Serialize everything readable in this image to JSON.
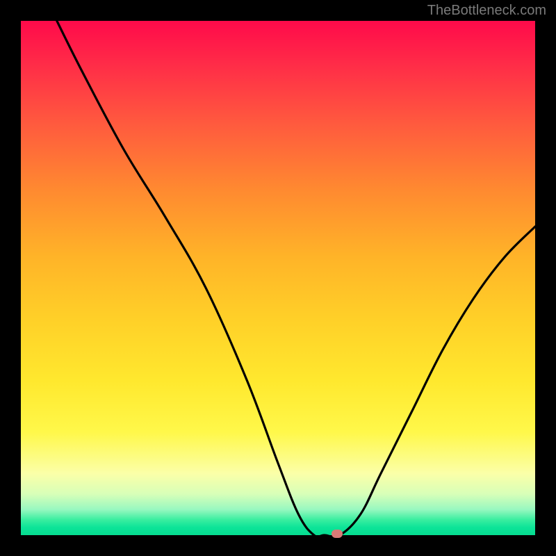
{
  "attribution": "TheBottleneck.com",
  "chart_data": {
    "type": "line",
    "title": "",
    "xlabel": "",
    "ylabel": "",
    "xlim": [
      0,
      100
    ],
    "ylim": [
      0,
      100
    ],
    "series": [
      {
        "name": "curve",
        "x": [
          7,
          12,
          20,
          28,
          36,
          44,
          50,
          54,
          57,
          59,
          62,
          66,
          70,
          76,
          82,
          88,
          94,
          100
        ],
        "y": [
          100,
          90,
          75,
          62,
          48,
          30,
          14,
          4,
          0,
          0,
          0,
          4,
          12,
          24,
          36,
          46,
          54,
          60
        ]
      }
    ],
    "marker": {
      "x": 61.5,
      "y": 0
    },
    "background_gradient": {
      "top": "#ff0a4a",
      "mid": "#ffe82e",
      "bottom": "#06dc90"
    }
  }
}
